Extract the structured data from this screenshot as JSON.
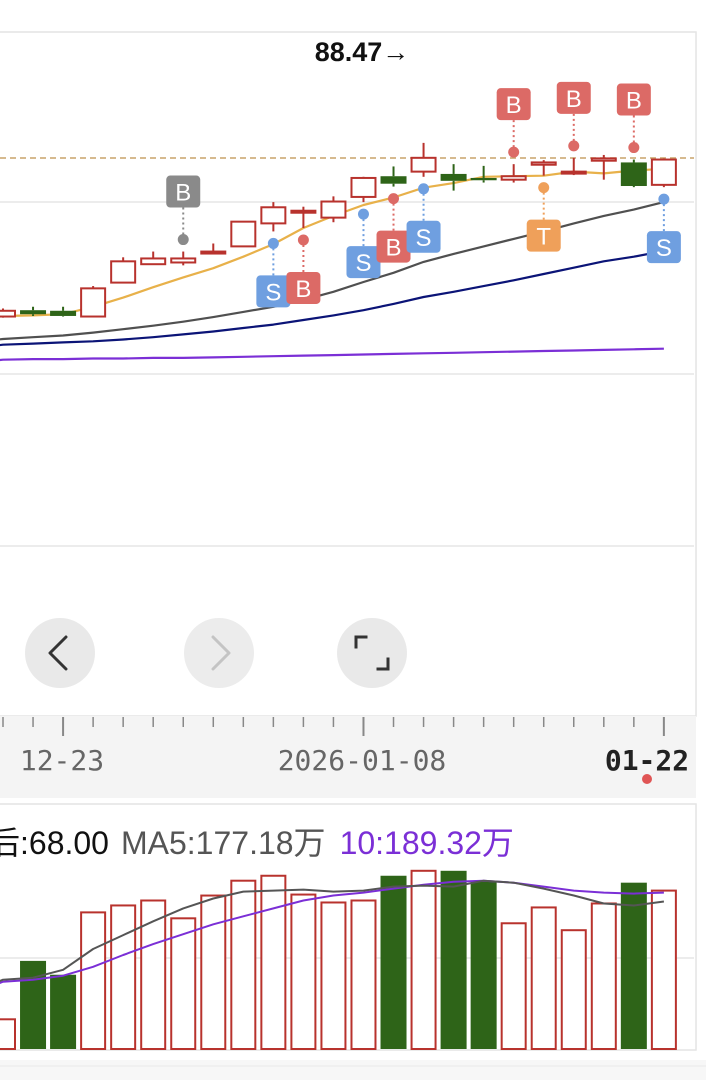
{
  "price_chart": {
    "peak_label": "88.47→",
    "colors": {
      "up": "#b8322d",
      "down": "#2e6418",
      "ma_short": "#e8b14a",
      "ma_mid": "#505050",
      "ma_long": "#0b1477",
      "ma_xlong": "#7b2fd6",
      "reference_line": "#c8a46a",
      "signal_buy": "#dc6a66",
      "signal_buy_grey": "#8a8a8a",
      "signal_sell": "#6f9fe0",
      "signal_t": "#efa05a"
    },
    "x_tick_labels": {
      "left": "12-23",
      "mid": "2026-01-08",
      "right": "01-22"
    },
    "nav": {
      "prev_icon": "chevron-left-icon",
      "next_icon": "chevron-right-icon",
      "fullscreen_icon": "fullscreen-icon"
    }
  },
  "volume_legend": {
    "current_label": "后:68.00",
    "ma5_label": "MA5:177.18万",
    "ma10_label": "10:189.32万",
    "ma5_color": "#555555",
    "ma10_color": "#7b2fd6"
  },
  "chart_data": [
    {
      "type": "candlestick",
      "x_axis_ticks": [
        "12-23",
        "2026-01-08",
        "01-22"
      ],
      "reference_price": 88.47,
      "candles": [
        {
          "o": 60.9,
          "c": 61.9,
          "h": 62.3,
          "l": 60.7,
          "dir": "up"
        },
        {
          "o": 62.0,
          "c": 61.3,
          "h": 62.6,
          "l": 61.0,
          "dir": "down"
        },
        {
          "o": 61.9,
          "c": 61.0,
          "h": 62.6,
          "l": 60.9,
          "dir": "down"
        },
        {
          "o": 60.9,
          "c": 65.8,
          "h": 66.2,
          "l": 60.8,
          "dir": "up"
        },
        {
          "o": 66.8,
          "c": 70.5,
          "h": 71.2,
          "l": 66.8,
          "dir": "up"
        },
        {
          "o": 70.0,
          "c": 71.0,
          "h": 72.2,
          "l": 70.0,
          "dir": "up"
        },
        {
          "o": 70.3,
          "c": 71.0,
          "h": 72.2,
          "l": 69.8,
          "dir": "up"
        },
        {
          "o": 72.1,
          "c": 72.2,
          "h": 73.6,
          "l": 71.8,
          "dir": "up"
        },
        {
          "o": 73.1,
          "c": 77.4,
          "h": 77.5,
          "l": 73.0,
          "dir": "up"
        },
        {
          "o": 77.1,
          "c": 79.9,
          "h": 80.8,
          "l": 75.7,
          "dir": "up"
        },
        {
          "o": 79.0,
          "c": 79.3,
          "h": 80.0,
          "l": 76.3,
          "dir": "up"
        },
        {
          "o": 78.1,
          "c": 80.9,
          "h": 81.8,
          "l": 77.3,
          "dir": "up"
        },
        {
          "o": 81.7,
          "c": 85.0,
          "h": 85.2,
          "l": 80.8,
          "dir": "up"
        },
        {
          "o": 85.3,
          "c": 84.0,
          "h": 87.0,
          "l": 83.5,
          "dir": "down"
        },
        {
          "o": 86.1,
          "c": 88.5,
          "h": 91.1,
          "l": 85.2,
          "dir": "up"
        },
        {
          "o": 85.7,
          "c": 84.5,
          "h": 87.4,
          "l": 82.8,
          "dir": "down"
        },
        {
          "o": 85.0,
          "c": 84.6,
          "h": 87.1,
          "l": 84.2,
          "dir": "down"
        },
        {
          "o": 84.7,
          "c": 85.3,
          "h": 87.4,
          "l": 84.2,
          "dir": "up"
        },
        {
          "o": 87.3,
          "c": 87.7,
          "h": 88.1,
          "l": 85.4,
          "dir": "up"
        },
        {
          "o": 85.8,
          "c": 86.1,
          "h": 88.5,
          "l": 85.5,
          "dir": "up"
        },
        {
          "o": 88.0,
          "c": 88.4,
          "h": 89.0,
          "l": 84.7,
          "dir": "up"
        },
        {
          "o": 87.7,
          "c": 83.6,
          "h": 88.2,
          "l": 83.4,
          "dir": "down"
        },
        {
          "o": 83.8,
          "c": 88.2,
          "h": 88.4,
          "l": 83.4,
          "dir": "up"
        }
      ],
      "ma_short": [
        61.0,
        61.1,
        61.3,
        62.6,
        64.2,
        66.0,
        67.7,
        69.3,
        71.3,
        73.5,
        76.3,
        78.4,
        80.3,
        81.6,
        83.3,
        84.1,
        85.2,
        85.3,
        85.4,
        86.1,
        85.8,
        86.3,
        86.6
      ],
      "ma_mid": [
        57.0,
        57.3,
        57.6,
        58.1,
        58.7,
        59.3,
        60.0,
        60.8,
        61.7,
        62.6,
        63.8,
        65.2,
        66.9,
        68.5,
        70.4,
        71.8,
        73.1,
        74.4,
        75.7,
        77.1,
        78.4,
        79.5,
        80.8
      ],
      "ma_long": [
        56.0,
        56.2,
        56.4,
        56.6,
        56.9,
        57.3,
        57.8,
        58.3,
        58.9,
        59.5,
        60.3,
        61.1,
        62.0,
        63.1,
        64.3,
        65.2,
        66.2,
        67.2,
        68.3,
        69.4,
        70.5,
        71.3,
        72.3
      ],
      "ma_xlong": [
        53.4,
        53.5,
        53.5,
        53.6,
        53.6,
        53.7,
        53.7,
        53.8,
        53.9,
        54.0,
        54.1,
        54.2,
        54.3,
        54.4,
        54.5,
        54.6,
        54.7,
        54.8,
        54.9,
        55.0,
        55.1,
        55.2,
        55.3
      ],
      "signals": [
        {
          "index": 6,
          "label": "B",
          "kind": "buy_grey",
          "pos": "above"
        },
        {
          "index": 9,
          "label": "S",
          "kind": "sell",
          "pos": "below"
        },
        {
          "index": 10,
          "label": "B",
          "kind": "buy",
          "pos": "below"
        },
        {
          "index": 12,
          "label": "S",
          "kind": "sell",
          "pos": "below"
        },
        {
          "index": 13,
          "label": "B",
          "kind": "buy",
          "pos": "below"
        },
        {
          "index": 14,
          "label": "S",
          "kind": "sell",
          "pos": "below"
        },
        {
          "index": 17,
          "label": "B",
          "kind": "buy",
          "pos": "above"
        },
        {
          "index": 18,
          "label": "T",
          "kind": "t",
          "pos": "below"
        },
        {
          "index": 19,
          "label": "B",
          "kind": "buy",
          "pos": "above"
        },
        {
          "index": 21,
          "label": "B",
          "kind": "buy",
          "pos": "above"
        },
        {
          "index": 22,
          "label": "S",
          "kind": "sell",
          "pos": "below"
        }
      ]
    },
    {
      "type": "bar",
      "unit": "万",
      "volumes": [
        30,
        89,
        75,
        138,
        145,
        150,
        132,
        155,
        170,
        175,
        156,
        148,
        150,
        175,
        180,
        180,
        170,
        127,
        143,
        120,
        147,
        168,
        160
      ],
      "volume_dir": [
        "up",
        "down",
        "down",
        "up",
        "up",
        "up",
        "up",
        "up",
        "up",
        "up",
        "up",
        "up",
        "up",
        "down",
        "up",
        "down",
        "down",
        "up",
        "up",
        "up",
        "up",
        "down",
        "up"
      ],
      "ma5": [
        70,
        72,
        80,
        101,
        115,
        129,
        142,
        152,
        159,
        160,
        161,
        159,
        160,
        164,
        165,
        164,
        170,
        168,
        162,
        155,
        147,
        145,
        149
      ],
      "ma10": [
        68,
        70,
        74,
        83,
        95,
        106,
        116,
        126,
        134,
        142,
        150,
        155,
        158,
        162,
        166,
        169,
        170,
        168,
        164,
        160,
        158,
        157,
        158
      ]
    }
  ]
}
